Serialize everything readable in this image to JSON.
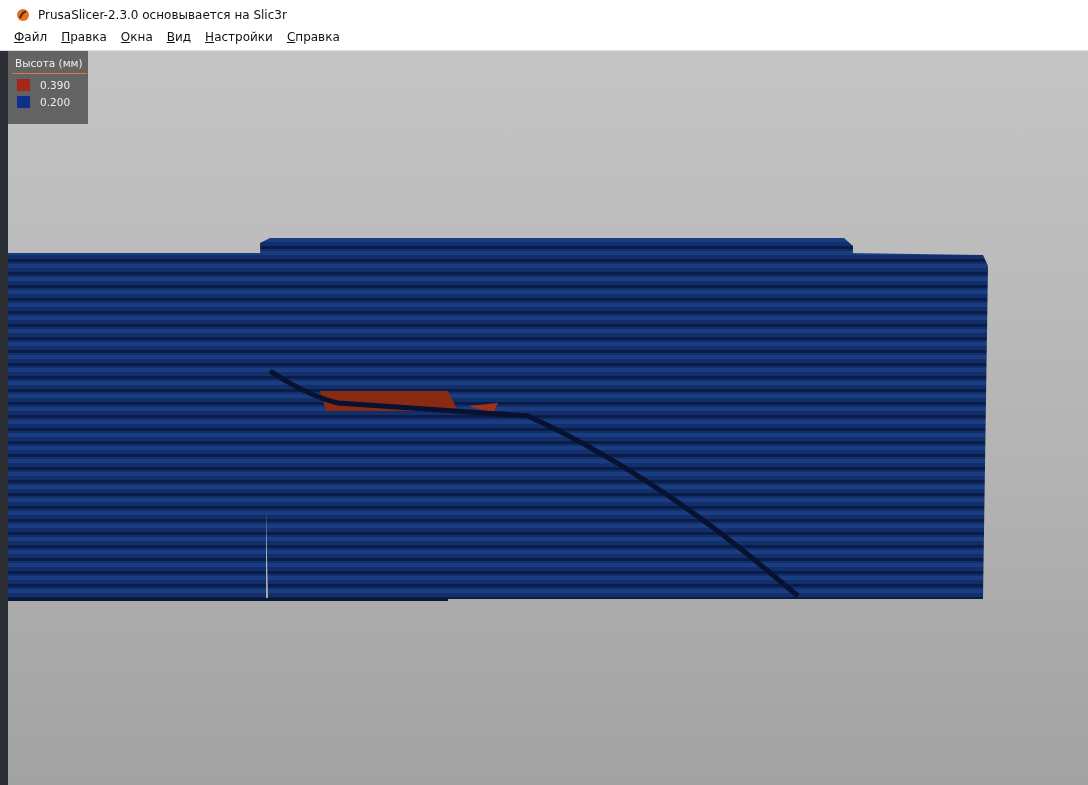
{
  "window": {
    "title": "PrusaSlicer-2.3.0 основывается на Slic3r"
  },
  "menu": [
    "Файл",
    "Правка",
    "Окна",
    "Вид",
    "Настройки",
    "Справка"
  ],
  "legend": {
    "title": "Высота (мм)",
    "items": [
      {
        "label": "0.390",
        "color": "#a3281a"
      },
      {
        "label": "0.200",
        "color": "#0f2f8a"
      }
    ]
  }
}
